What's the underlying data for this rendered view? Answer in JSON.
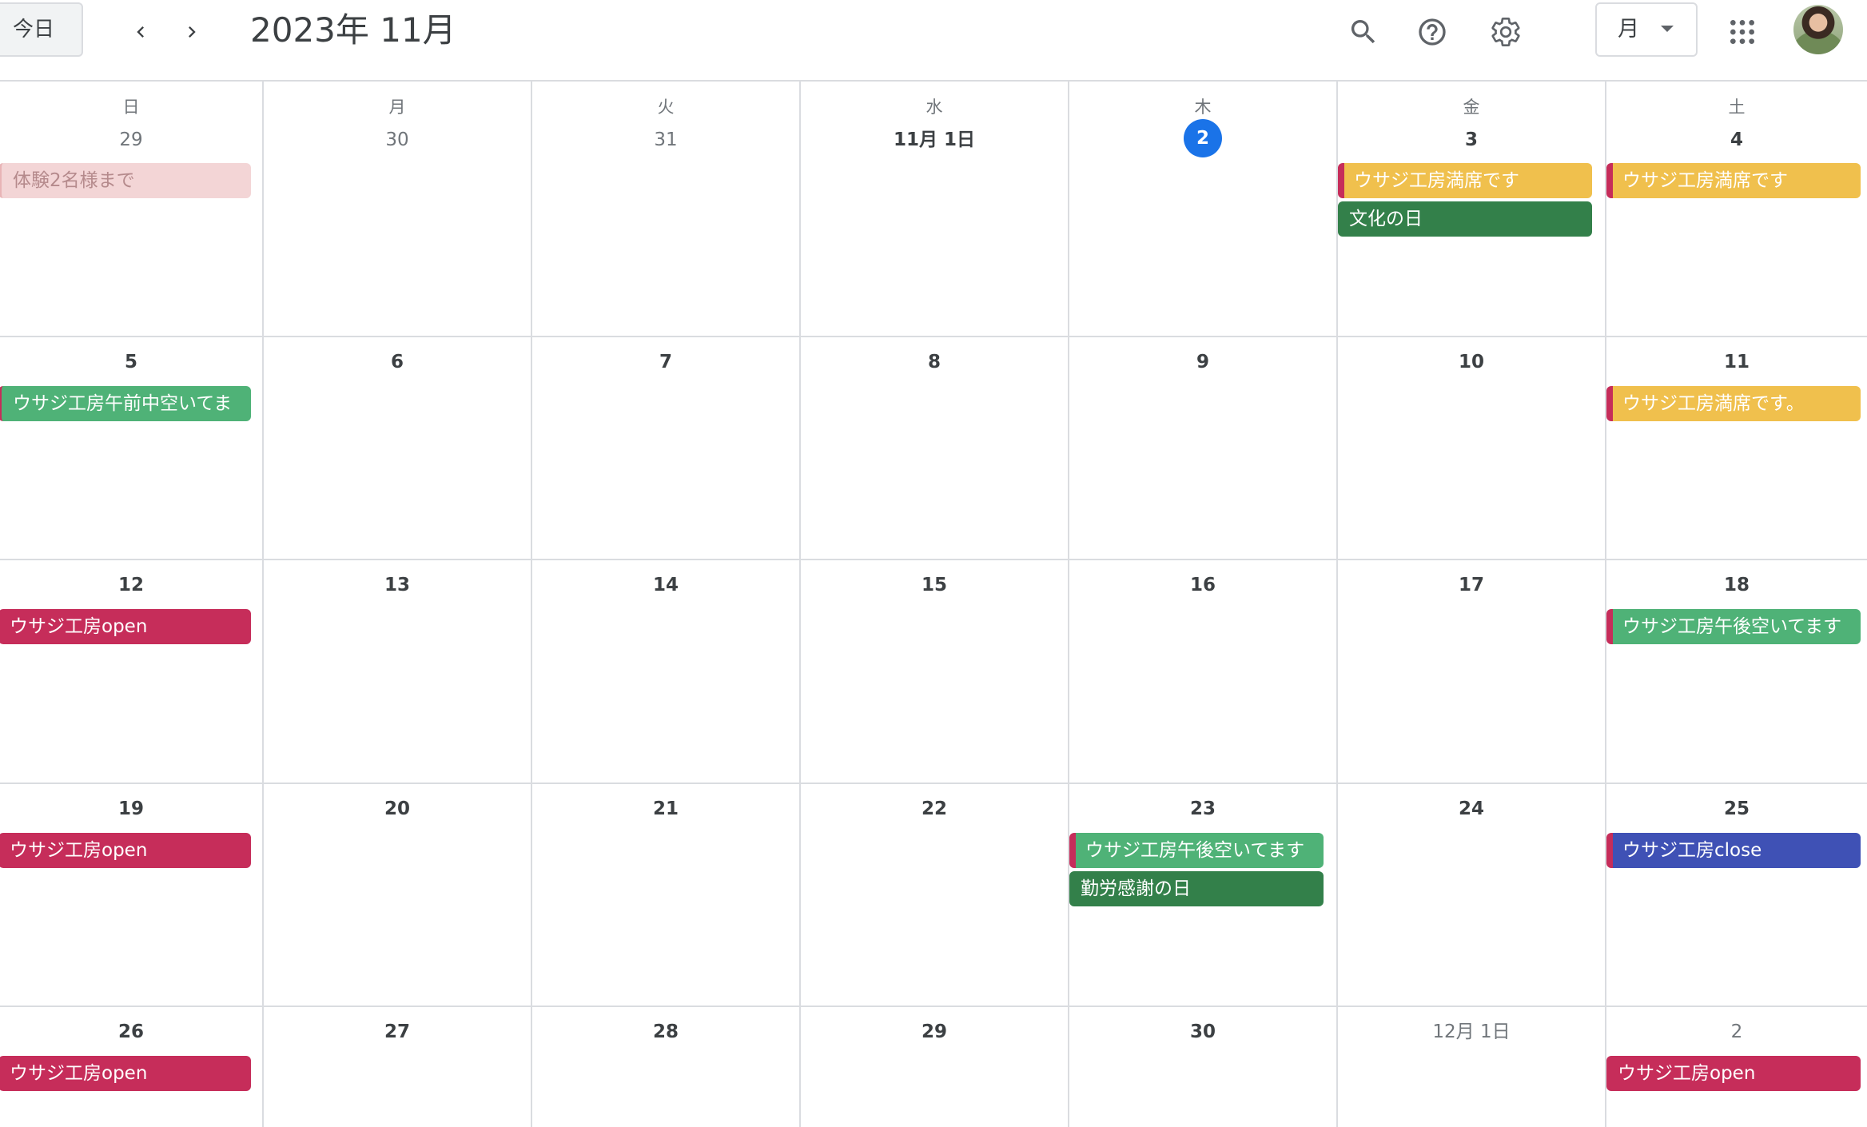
{
  "header": {
    "today_label": "今日",
    "title": "2023年 11月",
    "view_label": "月",
    "icons": {
      "prev": "chevron-left",
      "next": "chevron-right",
      "search": "search",
      "help": "help",
      "settings": "settings",
      "apps": "apps-grid"
    }
  },
  "weekdays": [
    "日",
    "月",
    "火",
    "水",
    "木",
    "金",
    "土"
  ],
  "colors": {
    "accent": "#1a73e8",
    "banana": "#f0c04d",
    "basil": "#33804a",
    "sage": "#4fb277",
    "cherry": "#c62d5a",
    "blueberry": "#3f51b5",
    "flamingo_faded": "#f3d5d6",
    "today_bg": "#1a73e8"
  },
  "weeks": [
    {
      "days": [
        "29",
        "30",
        "31",
        "11月 1日",
        "2",
        "3",
        "4"
      ]
    },
    {
      "days": [
        "5",
        "6",
        "7",
        "8",
        "9",
        "10",
        "11"
      ]
    },
    {
      "days": [
        "12",
        "13",
        "14",
        "15",
        "16",
        "17",
        "18"
      ]
    },
    {
      "days": [
        "19",
        "20",
        "21",
        "22",
        "23",
        "24",
        "25"
      ]
    },
    {
      "days": [
        "26",
        "27",
        "28",
        "29",
        "30",
        "12月 1日",
        "2"
      ]
    }
  ],
  "today": {
    "week": 0,
    "day": 4
  },
  "events": {
    "w0_d0": "体験2名様まで",
    "w0_d5_a": "ウサジ工房満席です",
    "w0_d5_b": "文化の日",
    "w0_d6": "ウサジ工房満席です",
    "w1_d0": "ウサジ工房午前中空いてま",
    "w1_d6": "ウサジ工房満席です。",
    "w2_d0": "ウサジ工房open",
    "w2_d6": "ウサジ工房午後空いてます",
    "w3_d0": "ウサジ工房open",
    "w3_d4_a": "ウサジ工房午後空いてます",
    "w3_d4_b": "勤労感謝の日",
    "w3_d6": "ウサジ工房close",
    "w4_d0": "ウサジ工房open",
    "w4_d6": "ウサジ工房open"
  }
}
